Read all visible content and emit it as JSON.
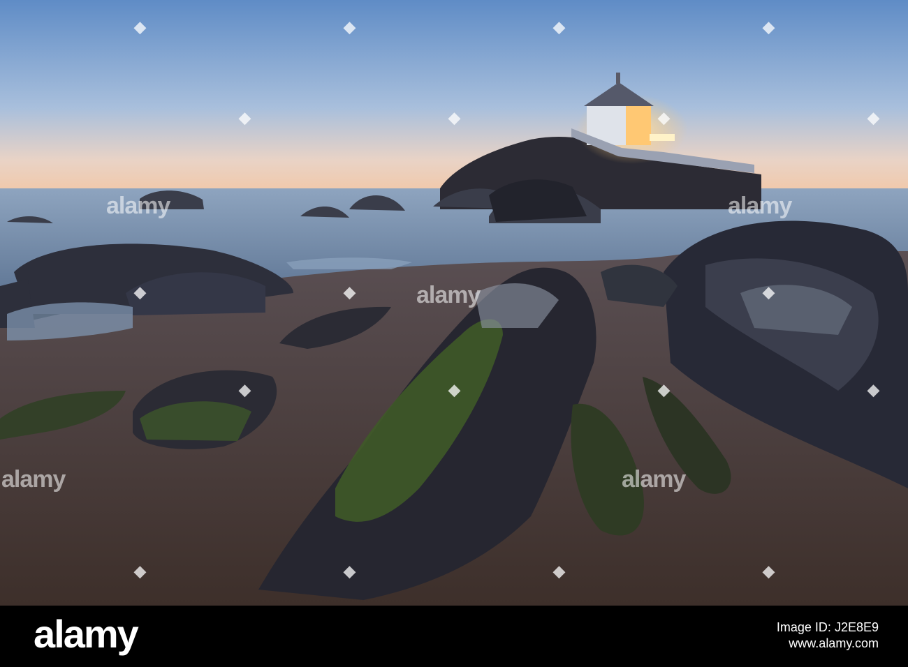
{
  "photo": {
    "scene": "Coastal chapel on rocky outcrop at dusk",
    "colors": {
      "sky_top": "#5f8cc6",
      "sky_horizon": "#f2c7a6",
      "sea": "#6d88a8",
      "sand": "#4a3c36",
      "moss": "#415a2a",
      "chapel_light": "#ffc873"
    }
  },
  "watermark": {
    "text": "alamy"
  },
  "footer": {
    "logo": "alamy",
    "image_id_label": "Image ID:",
    "image_id": "J2E8E9",
    "site": "www.alamy.com"
  }
}
